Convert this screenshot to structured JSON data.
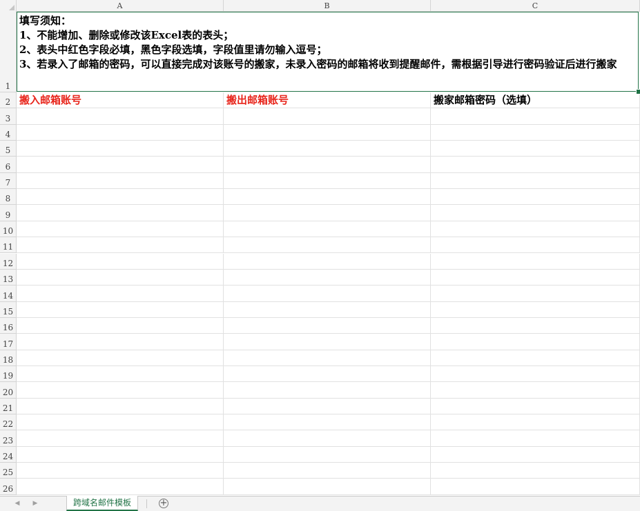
{
  "columns": [
    "A",
    "B",
    "C"
  ],
  "rows": [
    "1",
    "2",
    "3",
    "4",
    "5",
    "6",
    "7",
    "8",
    "9",
    "10",
    "11",
    "12",
    "13",
    "14",
    "15",
    "16",
    "17",
    "18",
    "19",
    "20",
    "21",
    "22",
    "23",
    "24",
    "25",
    "26"
  ],
  "instructions": {
    "line1": "填写须知：",
    "line2": "1、不能增加、删除或修改该Excel表的表头；",
    "line3": "2、表头中红色字段必填，黑色字段选填，字段值里请勿输入逗号；",
    "line4": "3、若录入了邮箱的密码，可以直接完成对该账号的搬家，未录入密码的邮箱将收到提醒邮件，需根据引导进行密码验证后进行搬家"
  },
  "headers": {
    "a": "搬入邮箱账号",
    "b": "搬出邮箱账号",
    "c": "搬家邮箱密码（选填）"
  },
  "colors": {
    "required": "#e8261c",
    "optional": "#000000",
    "accent": "#217346"
  },
  "tabs": {
    "prev_icon": "chevron-left-icon",
    "next_icon": "chevron-right-icon",
    "active": "跨域名邮件模板",
    "add_icon": "plus-circle-icon"
  }
}
